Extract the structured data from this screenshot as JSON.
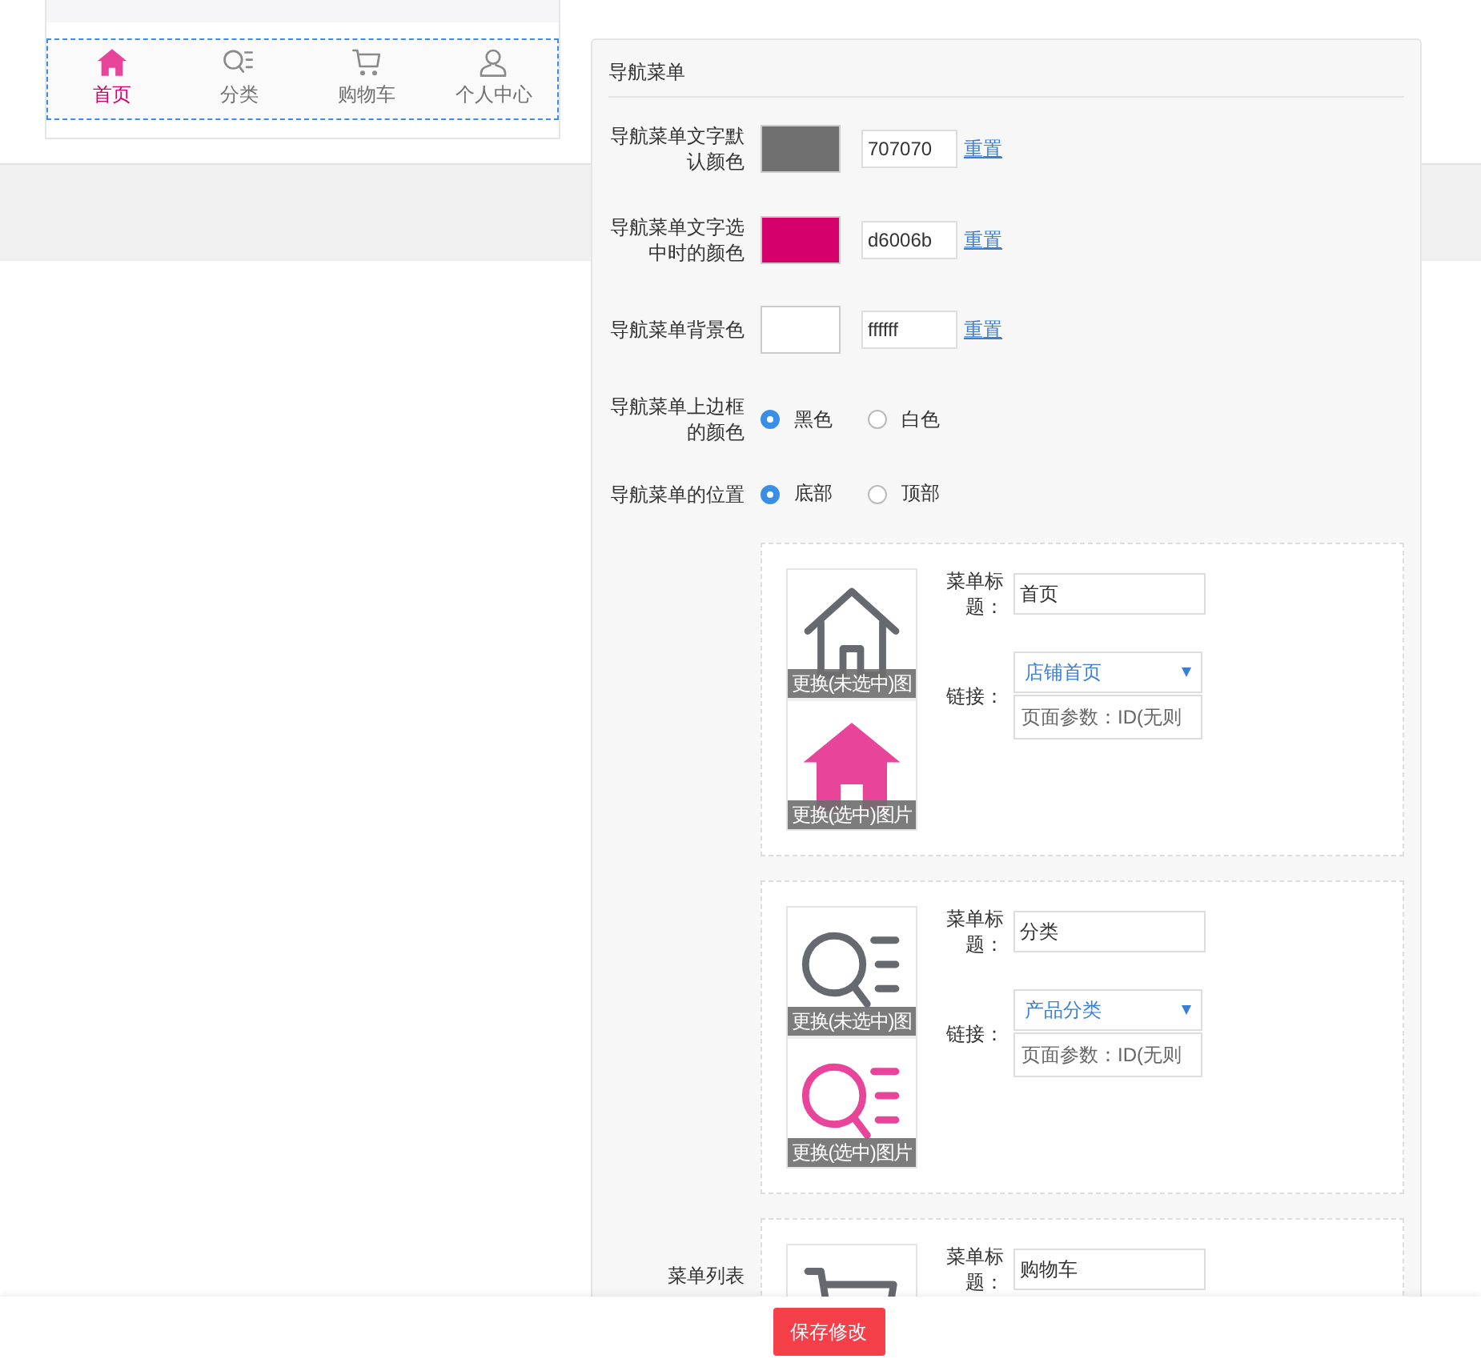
{
  "preview_nav": [
    {
      "kind": "home",
      "label": "首页",
      "selected": true
    },
    {
      "kind": "category",
      "label": "分类",
      "selected": false
    },
    {
      "kind": "cart",
      "label": "购物车",
      "selected": false
    },
    {
      "kind": "user",
      "label": "个人中心",
      "selected": false
    }
  ],
  "panel": {
    "title": "导航菜单",
    "settings": [
      {
        "kind": "color",
        "label": "导航菜单文字默认颜色",
        "color": "#707070",
        "value": "707070",
        "reset": "重置"
      },
      {
        "kind": "color",
        "label": "导航菜单文字选中时的颜色",
        "color": "#d6006b",
        "value": "d6006b",
        "reset": "重置"
      },
      {
        "kind": "color",
        "label": "导航菜单背景色",
        "color": "#ffffff",
        "value": "ffffff",
        "reset": "重置"
      },
      {
        "kind": "radio",
        "label": "导航菜单上边框的颜色",
        "options": [
          {
            "label": "黑色",
            "selected": true
          },
          {
            "label": "白色",
            "selected": false
          }
        ]
      },
      {
        "kind": "radio",
        "label": "导航菜单的位置",
        "options": [
          {
            "label": "底部",
            "selected": true
          },
          {
            "label": "顶部",
            "selected": false
          }
        ]
      }
    ],
    "menu_list": {
      "label": "菜单列表",
      "items": [
        {
          "kind": "home",
          "normal_caption": "更换(未选中)图",
          "active_caption": "更换(选中)图片",
          "title_label": "菜单标题：",
          "title_value": "首页",
          "link_label": "链接：",
          "link_value": "店铺首页",
          "param_placeholder": "页面参数：ID(无则"
        },
        {
          "kind": "category",
          "normal_caption": "更换(未选中)图",
          "active_caption": "更换(选中)图片",
          "title_label": "菜单标题：",
          "title_value": "分类",
          "link_label": "链接：",
          "link_value": "产品分类",
          "param_placeholder": "页面参数：ID(无则"
        },
        {
          "kind": "cart",
          "title_label": "菜单标题：",
          "title_value": "购物车"
        }
      ]
    }
  },
  "save_button": "保存修改"
}
